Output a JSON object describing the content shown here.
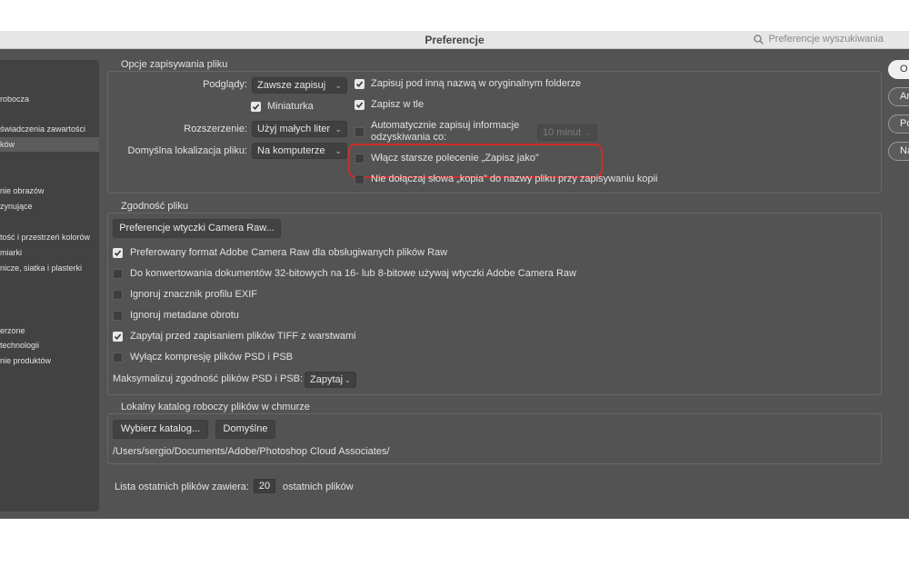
{
  "window": {
    "title": "Preferencje",
    "search_placeholder": "Preferencje wyszukiwania"
  },
  "sidebar": {
    "items": [
      "robocza",
      "świadczenia zawartości",
      "ków",
      "nie obrazów",
      "zynujące",
      "tość i przestrzeń kolorów",
      "miarki",
      "nicze, siatka i plasterki",
      "erzone",
      "technologii",
      "nie produktów"
    ]
  },
  "save_options": {
    "legend": "Opcje zapisywania pliku",
    "preview_label": "Podglądy:",
    "preview_value": "Zawsze zapisuj",
    "thumbnail_label": "Miniaturka",
    "thumbnail_checked": true,
    "extension_label": "Rozszerzenie:",
    "extension_value": "Użyj małych liter",
    "default_location_label": "Domyślna lokalizacja pliku:",
    "default_location_value": "Na komputerze",
    "save_as_original_label": "Zapisuj pod inną nazwą w oryginalnym folderze",
    "save_as_original_checked": true,
    "save_background_label": "Zapisz w tle",
    "save_background_checked": true,
    "autosave_label_line1": "Automatycznie zapisuj informacje",
    "autosave_label_line2": "odzyskiwania co:",
    "autosave_checked": false,
    "autosave_interval": "10 minut",
    "legacy_save_as_label": "Włącz starsze polecenie „Zapisz jako”",
    "legacy_save_as_checked": false,
    "no_copy_label": "Nie dołączaj słowa „kopia” do nazwy pliku przy zapisywaniu kopii",
    "no_copy_checked": false
  },
  "compatibility": {
    "legend": "Zgodność pliku",
    "camera_raw_button": "Preferencje wtyczki Camera Raw...",
    "options": [
      {
        "label": "Preferowany format Adobe Camera Raw dla obsługiwanych plików Raw",
        "checked": true
      },
      {
        "label": "Do konwertowania dokumentów 32-bitowych na 16- lub 8-bitowe używaj wtyczki Adobe Camera Raw",
        "checked": false
      },
      {
        "label": "Ignoruj znacznik profilu EXIF",
        "checked": false
      },
      {
        "label": "Ignoruj metadane obrotu",
        "checked": false
      },
      {
        "label": "Zapytaj przed zapisaniem plików TIFF z warstwami",
        "checked": true
      },
      {
        "label": "Wyłącz kompresję plików PSD i PSB",
        "checked": false
      }
    ],
    "maximize_label": "Maksymalizuj zgodność plików PSD i PSB:",
    "maximize_value": "Zapytaj"
  },
  "cloud": {
    "legend": "Lokalny katalog roboczy plików w chmurze",
    "choose_button": "Wybierz katalog...",
    "default_button": "Domyślne",
    "path": "/Users/sergio/Documents/Adobe/Photoshop Cloud Associates/"
  },
  "recent_files": {
    "label_before": "Lista ostatnich plików zawiera:",
    "value": "20",
    "label_after": "ostatnich plików"
  },
  "side_buttons": [
    "O",
    "An",
    "Po",
    "Na"
  ],
  "colors": {
    "panel_bg": "#535353",
    "highlight_border": "#cf2c28"
  }
}
